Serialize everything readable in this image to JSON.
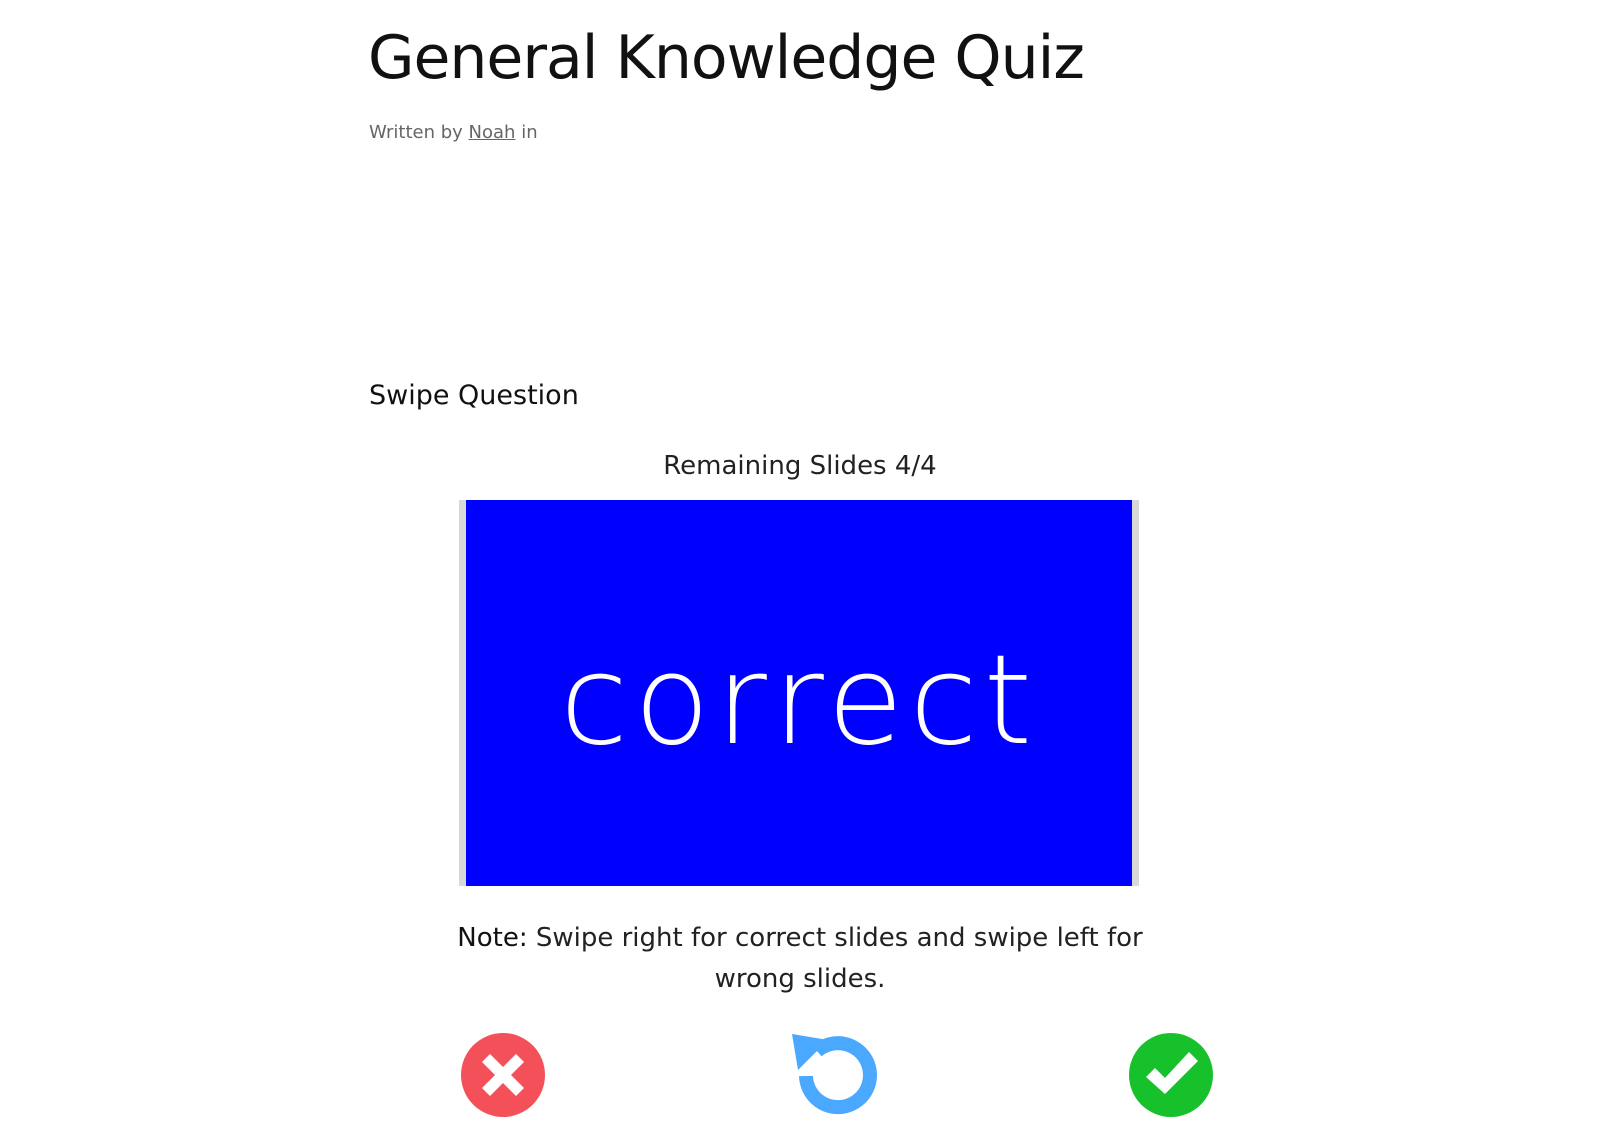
{
  "article": {
    "title": "General Knowledge Quiz",
    "byline_prefix": "Written by",
    "author": "Noah",
    "byline_suffix": "in"
  },
  "question": {
    "heading": "Swipe Question",
    "remaining_label": "Remaining Slides 4/4",
    "slide_text": "correct",
    "slide_color": "#0000ff",
    "note_label": "Note:",
    "note_text": "Swipe right for correct slides and swipe left for wrong slides."
  },
  "controls": {
    "wrong_icon": "close-icon",
    "wrong_color": "#f4505a",
    "reset_icon": "undo-icon",
    "reset_color": "#4aa8ff",
    "correct_icon": "check-icon",
    "correct_color": "#17c12b"
  }
}
